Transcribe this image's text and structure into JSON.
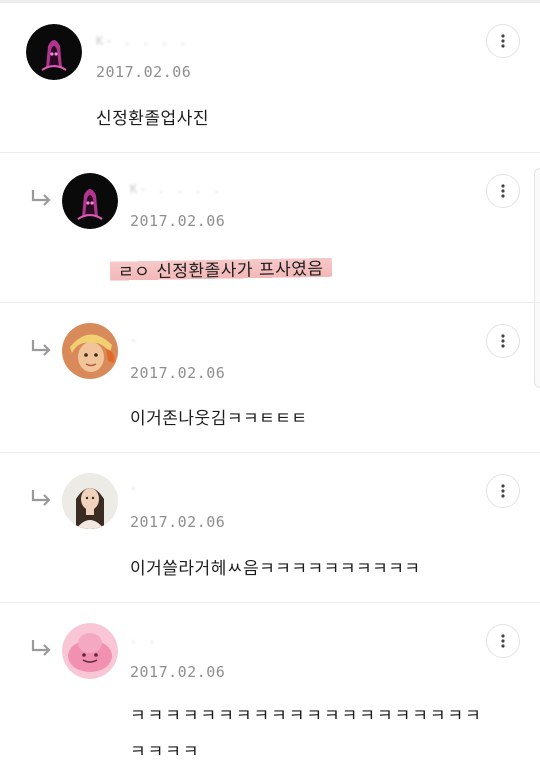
{
  "comments": [
    {
      "name": "K-  . .  . .",
      "date": "2017.02.06",
      "text": "신정환졸업사진",
      "is_reply": false,
      "avatar": "ghost-avatar"
    },
    {
      "name": "K-  . . . .",
      "date": "2017.02.06",
      "text": "ㄹㅇ 신정환졸사가 프사였음",
      "is_reply": true,
      "avatar": "ghost-avatar",
      "highlighted": true
    },
    {
      "name": "-",
      "date": "2017.02.06",
      "text": "이거존나웃김ㅋㅋㅌㅌㅌ",
      "is_reply": true,
      "avatar": "person-avatar"
    },
    {
      "name": "·",
      "date": "2017.02.06",
      "text": "이거쓸라거헤ㅆ음ㅋㅋㅋㅋㅋㅋㅋㅋㅋㅋ",
      "is_reply": true,
      "avatar": "person-avatar"
    },
    {
      "name": "   . .",
      "date": "2017.02.06",
      "text": "ㅋㅋㅋㅋㅋㅋㅋㅋㅋㅋㅋㅋㅋㅋㅋㅋㅋㅋㅋㅋㅋㅋㅋㅋ",
      "is_reply": true,
      "avatar": "pink-character-avatar"
    }
  ],
  "colors": {
    "highlight": "#f4b7b7",
    "date": "#8e8e8e",
    "divider": "#ededed"
  },
  "icons": {
    "reply": "reply-arrow-icon",
    "more": "more-vertical-icon"
  }
}
